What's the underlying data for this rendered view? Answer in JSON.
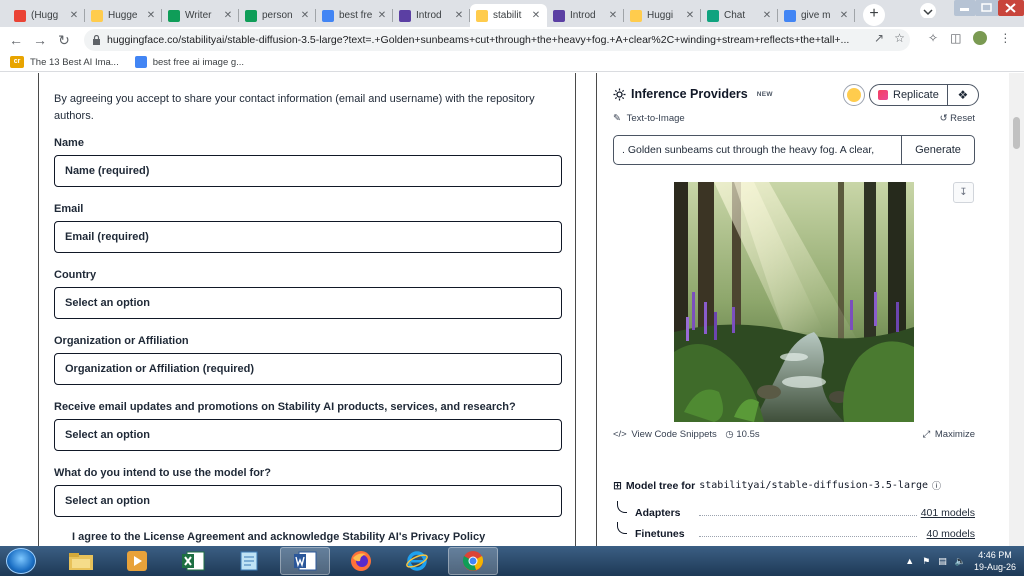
{
  "browser": {
    "tabs": [
      {
        "title": "(Hugg",
        "favicon": "gmail-icon",
        "color": "#ea4335",
        "active": false
      },
      {
        "title": "Hugge",
        "favicon": "hugging-face-icon",
        "color": "#ffcc4d",
        "active": false
      },
      {
        "title": "Writer",
        "favicon": "sheets-icon",
        "color": "#0f9d58",
        "active": false
      },
      {
        "title": "person",
        "favicon": "sheets-icon",
        "color": "#0f9d58",
        "active": false
      },
      {
        "title": "best fre",
        "favicon": "docs-icon",
        "color": "#4285f4",
        "active": false
      },
      {
        "title": "Introd",
        "favicon": "stability-icon",
        "color": "#5b3fa3",
        "active": false
      },
      {
        "title": "stabilit",
        "favicon": "hugging-face-icon",
        "color": "#ffcc4d",
        "active": true
      },
      {
        "title": "Introd",
        "favicon": "stability-icon",
        "color": "#5b3fa3",
        "active": false
      },
      {
        "title": "Huggi",
        "favicon": "hugging-face-icon",
        "color": "#ffcc4d",
        "active": false
      },
      {
        "title": "Chat",
        "favicon": "chatgpt-icon",
        "color": "#10a37f",
        "active": false
      },
      {
        "title": "give m",
        "favicon": "google-icon",
        "color": "#4285f4",
        "active": false
      }
    ],
    "url": "huggingface.co/stabilityai/stable-diffusion-3.5-large?text=.+Golden+sunbeams+cut+through+the+heavy+fog.+A+clear%2C+winding+stream+reflects+the+tall+...",
    "bookmarks": [
      {
        "label": "The 13 Best AI Ima...",
        "favicon": "cr-icon"
      },
      {
        "label": "best free ai image g...",
        "favicon": "docs-icon"
      }
    ]
  },
  "form": {
    "consent": "By agreeing you accept to share your contact information (email and username) with the repository authors.",
    "fields": [
      {
        "label": "Name",
        "value": "Name (required)"
      },
      {
        "label": "Email",
        "value": "Email (required)"
      },
      {
        "label": "Country",
        "value": "Select an option"
      },
      {
        "label": "Organization or Affiliation",
        "value": "Organization or Affiliation (required)"
      },
      {
        "label": "Receive email updates and promotions on Stability AI products, services, and research?",
        "value": "Select an option"
      },
      {
        "label": "What do you intend to use the model for?",
        "value": "Select an option"
      }
    ],
    "agree": "I agree to the License Agreement and acknowledge Stability AI's Privacy Policy"
  },
  "inference": {
    "title": "Inference Providers",
    "badge": "NEW",
    "provider": "Replicate",
    "task": "Text-to-Image",
    "reset": "Reset",
    "prompt": ". Golden sunbeams cut through the heavy fog. A clear,",
    "generate": "Generate",
    "view_code": "View Code Snippets",
    "time": "10.5s",
    "maximize": "Maximize"
  },
  "model_tree": {
    "label": "Model tree for",
    "model": "stabilityai/stable-diffusion-3.5-large",
    "rows": [
      {
        "name": "Adapters",
        "count": "401 models"
      },
      {
        "name": "Finetunes",
        "count": "40 models"
      }
    ]
  },
  "taskbar": {
    "time": "4:46 PM",
    "date": "19-Aug-26"
  }
}
